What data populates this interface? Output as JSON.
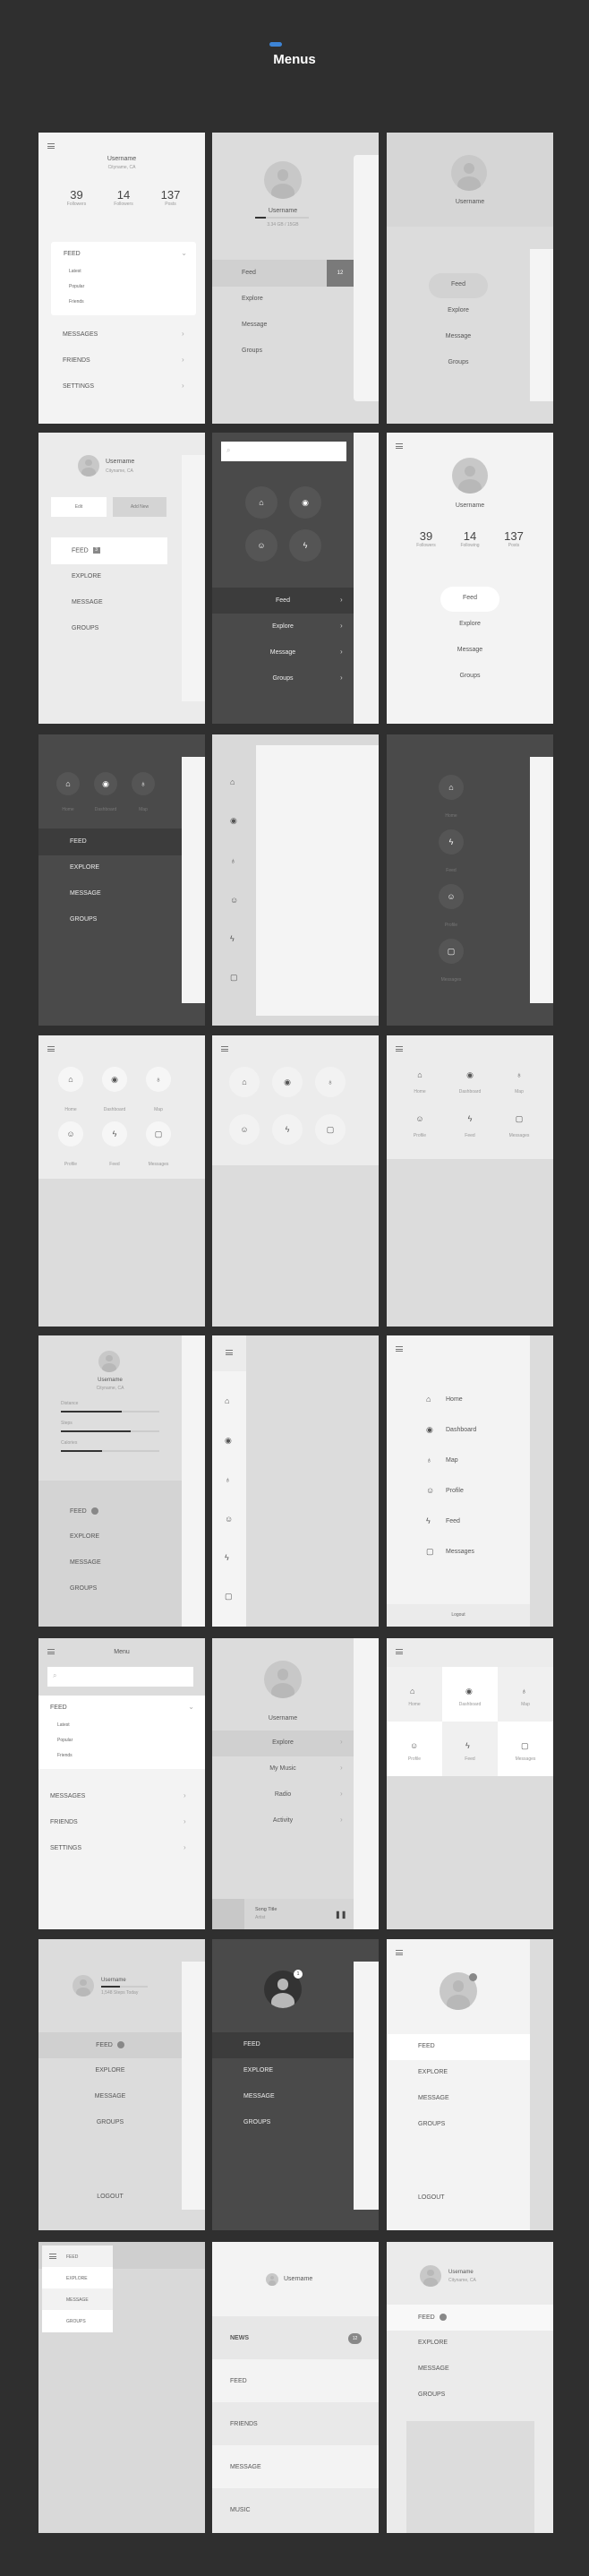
{
  "page": {
    "title": "Menus",
    "accent": "#3d84d6"
  },
  "common": {
    "username": "Username",
    "city": "Cityname, CA",
    "main_items": [
      "Feed",
      "Explore",
      "Message",
      "Groups"
    ],
    "icon_items": [
      "Home",
      "Dashboard",
      "Map",
      "Profile",
      "Feed",
      "Messages"
    ],
    "logout": "Logout"
  },
  "s1": {
    "stats": [
      {
        "value": "39",
        "label": "Followers"
      },
      {
        "value": "14",
        "label": "Followers"
      },
      {
        "value": "137",
        "label": "Posts"
      }
    ],
    "feed": "FEED",
    "sub": [
      "Latest",
      "Popular",
      "Friends"
    ],
    "items": [
      "MESSAGES",
      "FRIENDS",
      "SETTINGS"
    ]
  },
  "s2": {
    "storage": "3.34 GB / 15GB",
    "storage_fraction": 0.2,
    "feed_count": "12"
  },
  "s4": {
    "edit": "Edit",
    "add_new": "Add New",
    "feed_badge": "3",
    "items": [
      "FEED",
      "EXPLORE",
      "MESSAGE",
      "GROUPS"
    ]
  },
  "s6": {
    "stats": [
      {
        "value": "39",
        "label": "Followers"
      },
      {
        "value": "14",
        "label": "Following"
      },
      {
        "value": "137",
        "label": "Posts"
      }
    ]
  },
  "s13": {
    "metrics": [
      {
        "label": "Distance",
        "fraction": 0.62
      },
      {
        "label": "Steps",
        "fraction": 0.71
      },
      {
        "label": "Calories",
        "fraction": 0.42
      }
    ]
  },
  "s16": {
    "title": "Menu"
  },
  "s17": {
    "items": [
      "Explore",
      "My Music",
      "Radio",
      "Activity"
    ],
    "song": "Song Title",
    "artist": "Artist"
  },
  "s19": {
    "steps": "1,548 Steps Today",
    "steps_fraction": 0.4,
    "logout": "LOGOUT"
  },
  "s20": {
    "avatar_badge": "1"
  },
  "s23": {
    "items": [
      "NEWS",
      "FEED",
      "FRIENDS",
      "MESSAGE",
      "MUSIC"
    ],
    "news_count": "12"
  }
}
